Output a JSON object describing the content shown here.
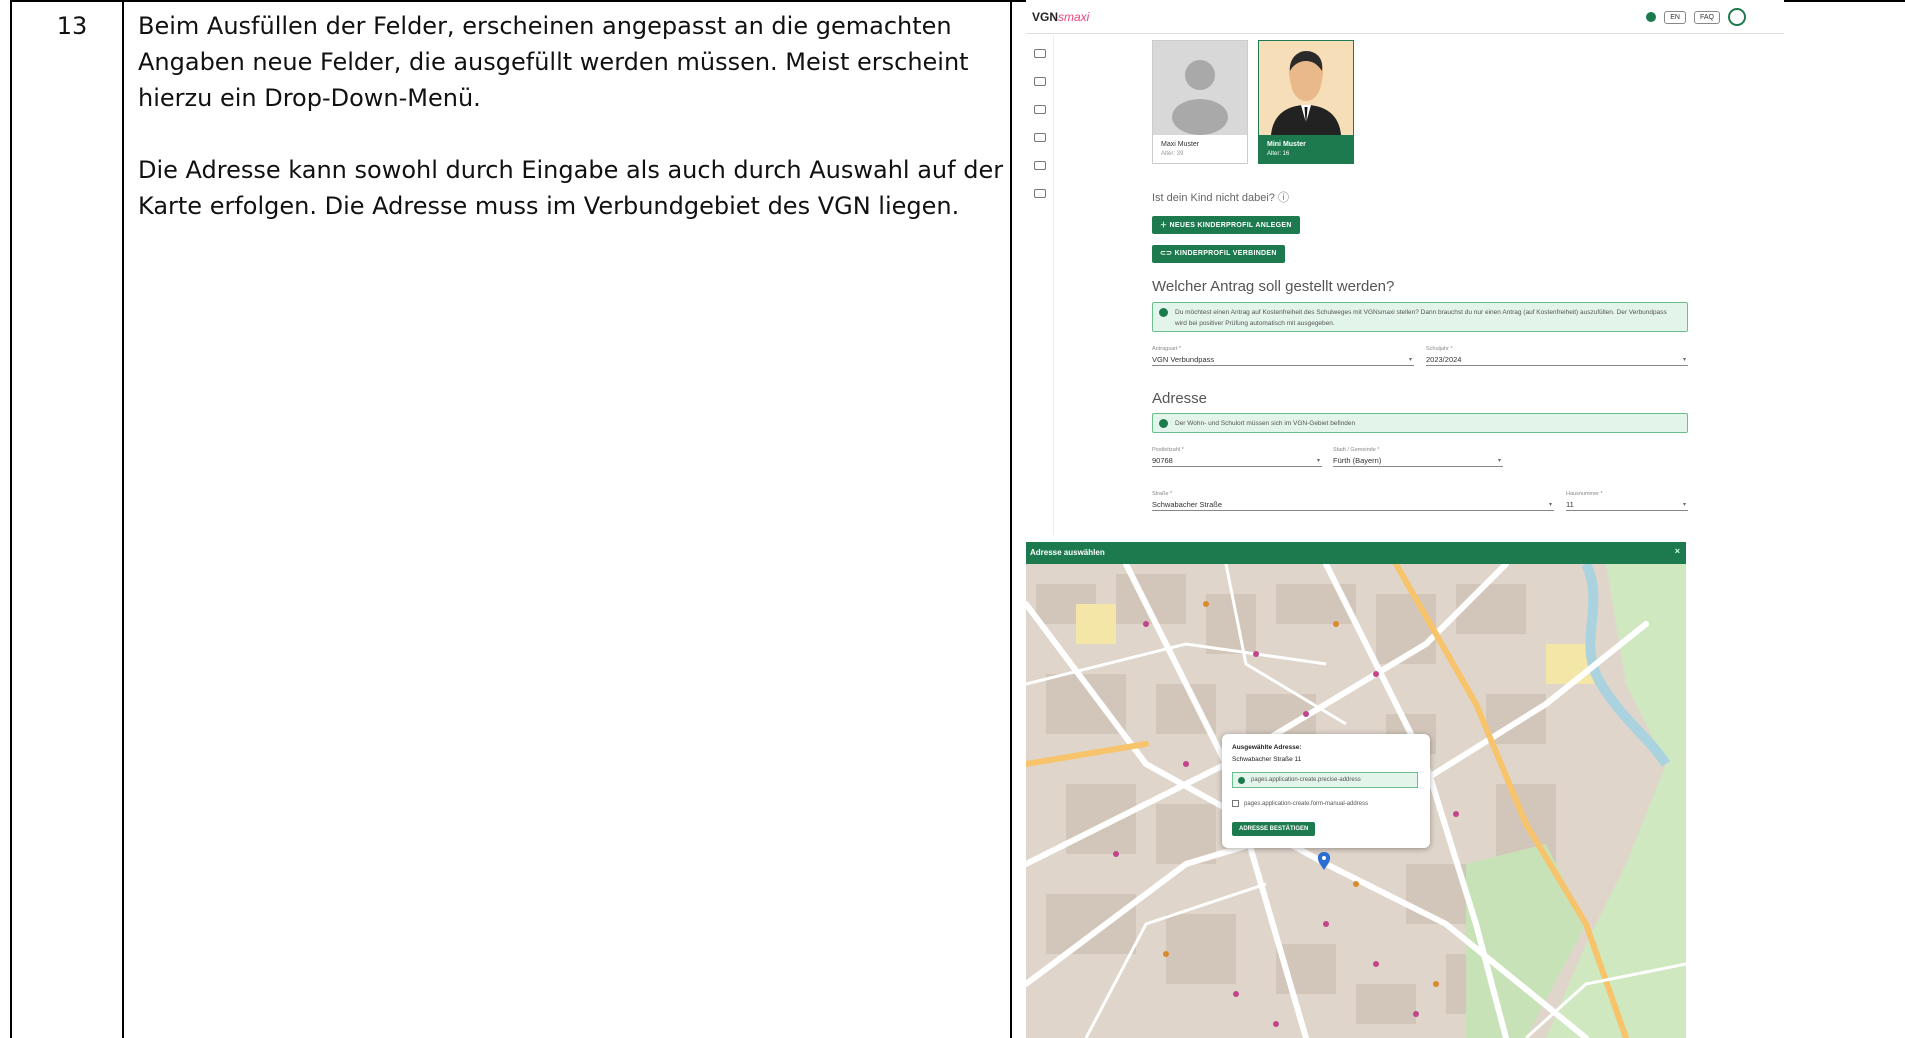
{
  "row": {
    "number": "13",
    "paragraphs": [
      "Beim Ausfüllen der Felder, erscheinen angepasst an die gemachten Angaben neue Felder, die ausgefüllt werden müssen. Meist erscheint hierzu ein Drop-Down-Menü.",
      "Die Adresse kann sowohl durch Eingabe als auch durch Auswahl auf der Karte erfolgen. Die Adresse muss im Verbundgebiet des VGN liegen."
    ]
  },
  "app": {
    "logo_main": "VGN",
    "logo_sub": "smaxi",
    "lang": "EN",
    "faq": "FAQ",
    "accent": "#1d7a4f"
  },
  "profiles": [
    {
      "name": "Maxi Muster",
      "age": "Alter: 39"
    },
    {
      "name": "Mini Muster",
      "age": "Alter: 16"
    }
  ],
  "form": {
    "child_question": "Ist dein Kind nicht dabei?",
    "btn_new_profile": "NEUES KINDERPROFIL ANLEGEN",
    "btn_connect_profile": "KINDERPROFIL VERBINDEN",
    "section_antrag": "Welcher Antrag soll gestellt werden?",
    "antrag_info": "Du möchtest einen Antrag auf Kostenfreiheit des Schulweges mit VGNsmaxi stellen? Dann brauchst du nur einen Antrag (auf Kostenfreiheit) auszufüllen. Der Verbundpass wird bei positiver Prüfung automatisch mit ausgegeben.",
    "antragsart_label": "Antragsart *",
    "antragsart_value": "VGN Verbundpass",
    "schuljahr_label": "Schuljahr *",
    "schuljahr_value": "2023/2024",
    "section_adresse": "Adresse",
    "adresse_info": "Der Wohn- und Schulort müssen sich im VGN-Gebiet befinden",
    "plz_label": "Postleitzahl *",
    "plz_value": "90768",
    "stadt_label": "Stadt / Gemeinde *",
    "stadt_value": "Fürth (Bayern)",
    "strasse_label": "Straße *",
    "strasse_value": "Schwabacher Straße",
    "hausnr_label": "Hausnummer *",
    "hausnr_value": "11"
  },
  "map": {
    "title": "Adresse auswählen",
    "close": "×",
    "popup_title": "Ausgewählte Adresse:",
    "popup_address": "Schwabacher Straße 11",
    "popup_info": "pages.application-create.precise-address",
    "popup_checkbox": "pages.application-create.form-manual-address",
    "popup_button": "ADRESSE BESTÄTIGEN"
  }
}
